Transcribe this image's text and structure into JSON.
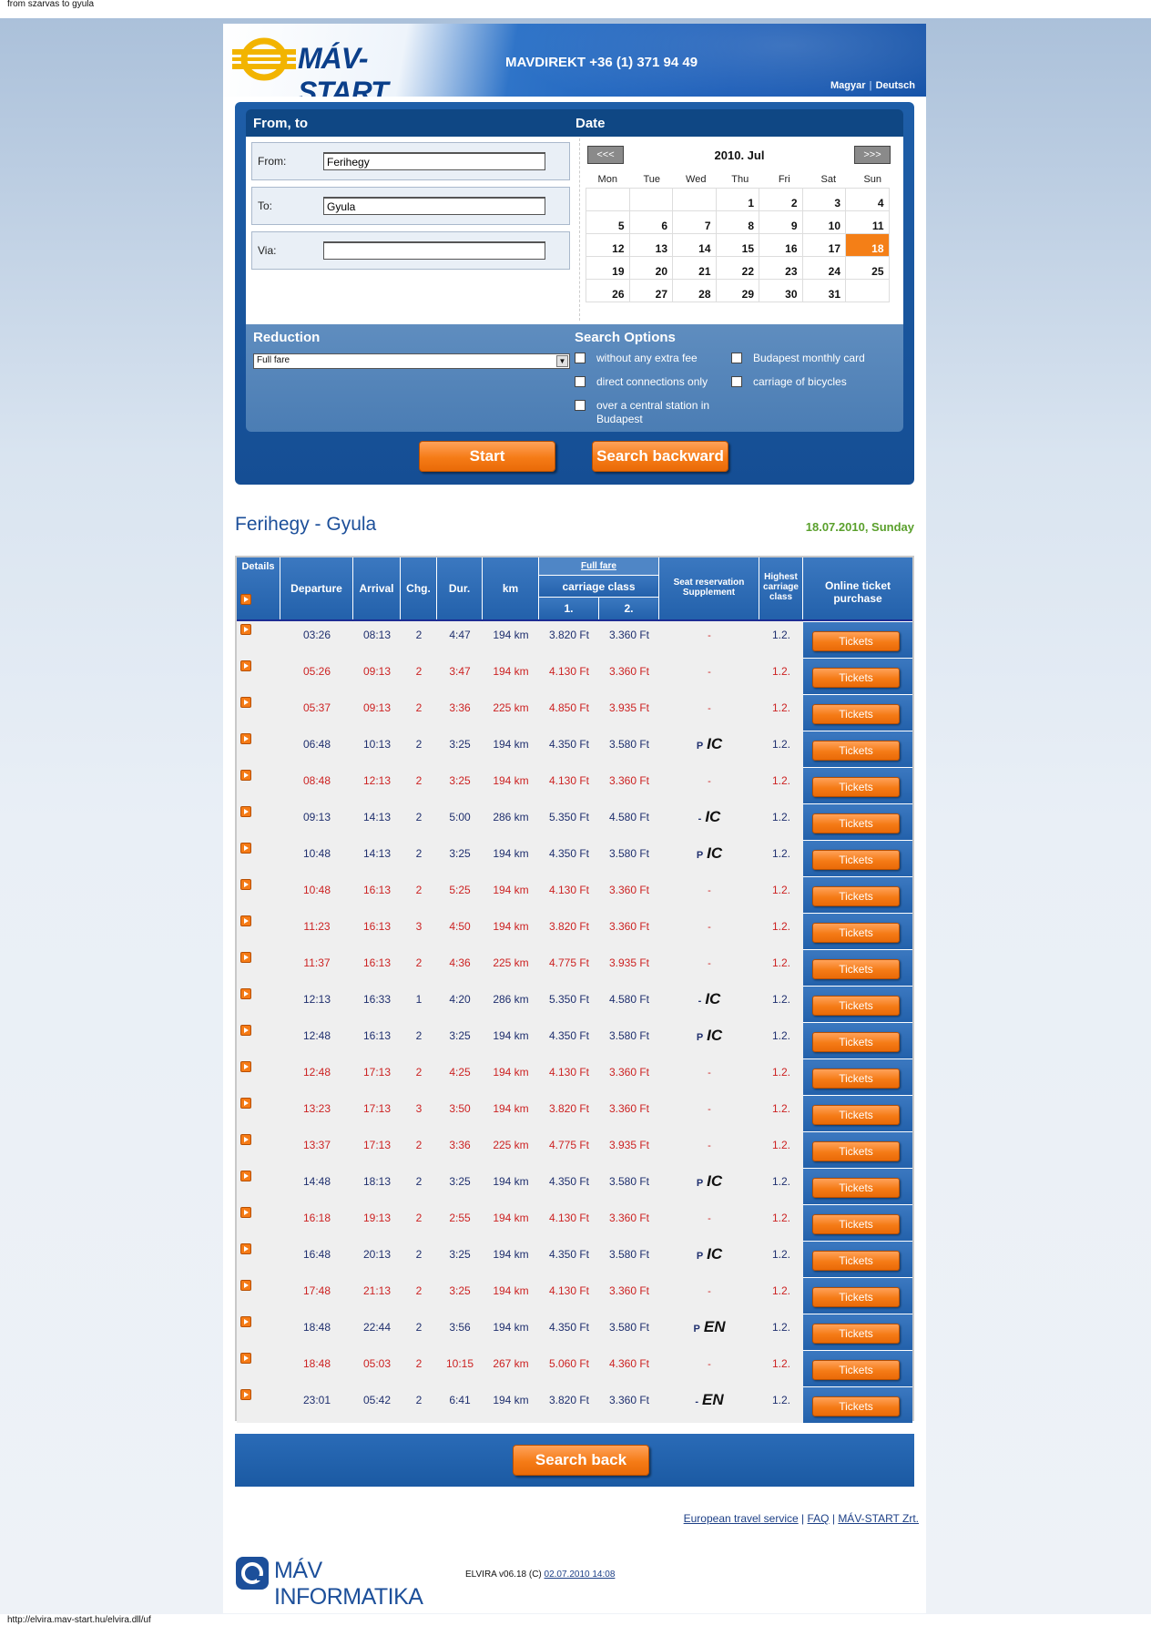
{
  "browser": {
    "page_title": "from szarvas to gyula",
    "status_url": "http://elvira.mav-start.hu/elvira.dll/uf"
  },
  "header": {
    "logo_text": "MÁV-START",
    "phone": "MAVDIREKT +36 (1) 371 94 49",
    "langs": [
      "Magyar",
      "Deutsch"
    ]
  },
  "search": {
    "from_to_title": "From, to",
    "date_title": "Date",
    "from_label": "From:",
    "from_value": "Ferihegy",
    "to_label": "To:",
    "to_value": "Gyula",
    "via_label": "Via:",
    "via_value": ""
  },
  "calendar": {
    "prev": "<<<",
    "next": ">>>",
    "title": "2010. Jul",
    "dow": [
      "Mon",
      "Tue",
      "Wed",
      "Thu",
      "Fri",
      "Sat",
      "Sun"
    ],
    "weeks": [
      [
        "",
        "",
        "",
        "1",
        "2",
        "3",
        "4"
      ],
      [
        "5",
        "6",
        "7",
        "8",
        "9",
        "10",
        "11"
      ],
      [
        "12",
        "13",
        "14",
        "15",
        "16",
        "17",
        "18"
      ],
      [
        "19",
        "20",
        "21",
        "22",
        "23",
        "24",
        "25"
      ],
      [
        "26",
        "27",
        "28",
        "29",
        "30",
        "31",
        ""
      ]
    ],
    "selected": "18"
  },
  "reduction": {
    "title": "Reduction",
    "selected": "Full fare"
  },
  "options": {
    "title": "Search Options",
    "items": [
      "without any extra fee",
      "direct connections only",
      "over a central station in Budapest",
      "Budapest monthly card",
      "carriage of bicycles"
    ]
  },
  "buttons": {
    "start": "Start",
    "search_backward": "Search backward",
    "search_back": "Search back"
  },
  "route": {
    "title": "Ferihegy - Gyula",
    "date": "18.07.2010, Sunday"
  },
  "table": {
    "headers": {
      "details": "Details",
      "departure": "Departure",
      "arrival": "Arrival",
      "changes": "Chg.",
      "duration": "Dur.",
      "km": "km",
      "full_fare": "Full fare",
      "carriage_class": "carriage class",
      "class1": "1.",
      "class2": "2.",
      "seat": "Seat reservation Supplement",
      "highest": "Highest carriage class",
      "online": "Online ticket purchase"
    },
    "ticket_label": "Tickets",
    "rows": [
      {
        "dep": "03:26",
        "arr": "08:13",
        "chg": "2",
        "dur": "4:47",
        "km": "194 km",
        "c1": "3.820 Ft",
        "c2": "3.360 Ft",
        "seat_mark": "",
        "seat_type": "",
        "seat_text": "-",
        "cls": "1.2.",
        "color": "blue"
      },
      {
        "dep": "05:26",
        "arr": "09:13",
        "chg": "2",
        "dur": "3:47",
        "km": "194 km",
        "c1": "4.130 Ft",
        "c2": "3.360 Ft",
        "seat_mark": "",
        "seat_type": "",
        "seat_text": "-",
        "cls": "1.2.",
        "color": "red"
      },
      {
        "dep": "05:37",
        "arr": "09:13",
        "chg": "2",
        "dur": "3:36",
        "km": "225 km",
        "c1": "4.850 Ft",
        "c2": "3.935 Ft",
        "seat_mark": "",
        "seat_type": "",
        "seat_text": "-",
        "cls": "1.2.",
        "color": "red"
      },
      {
        "dep": "06:48",
        "arr": "10:13",
        "chg": "2",
        "dur": "3:25",
        "km": "194 km",
        "c1": "4.350 Ft",
        "c2": "3.580 Ft",
        "seat_mark": "P",
        "seat_type": "IC",
        "seat_text": "",
        "cls": "1.2.",
        "color": "blue"
      },
      {
        "dep": "08:48",
        "arr": "12:13",
        "chg": "2",
        "dur": "3:25",
        "km": "194 km",
        "c1": "4.130 Ft",
        "c2": "3.360 Ft",
        "seat_mark": "",
        "seat_type": "",
        "seat_text": "-",
        "cls": "1.2.",
        "color": "red"
      },
      {
        "dep": "09:13",
        "arr": "14:13",
        "chg": "2",
        "dur": "5:00",
        "km": "286 km",
        "c1": "5.350 Ft",
        "c2": "4.580 Ft",
        "seat_mark": "-",
        "seat_type": "IC",
        "seat_text": "",
        "cls": "1.2.",
        "color": "blue"
      },
      {
        "dep": "10:48",
        "arr": "14:13",
        "chg": "2",
        "dur": "3:25",
        "km": "194 km",
        "c1": "4.350 Ft",
        "c2": "3.580 Ft",
        "seat_mark": "P",
        "seat_type": "IC",
        "seat_text": "",
        "cls": "1.2.",
        "color": "blue"
      },
      {
        "dep": "10:48",
        "arr": "16:13",
        "chg": "2",
        "dur": "5:25",
        "km": "194 km",
        "c1": "4.130 Ft",
        "c2": "3.360 Ft",
        "seat_mark": "",
        "seat_type": "",
        "seat_text": "-",
        "cls": "1.2.",
        "color": "red"
      },
      {
        "dep": "11:23",
        "arr": "16:13",
        "chg": "3",
        "dur": "4:50",
        "km": "194 km",
        "c1": "3.820 Ft",
        "c2": "3.360 Ft",
        "seat_mark": "",
        "seat_type": "",
        "seat_text": "-",
        "cls": "1.2.",
        "color": "red"
      },
      {
        "dep": "11:37",
        "arr": "16:13",
        "chg": "2",
        "dur": "4:36",
        "km": "225 km",
        "c1": "4.775 Ft",
        "c2": "3.935 Ft",
        "seat_mark": "",
        "seat_type": "",
        "seat_text": "-",
        "cls": "1.2.",
        "color": "red"
      },
      {
        "dep": "12:13",
        "arr": "16:33",
        "chg": "1",
        "dur": "4:20",
        "km": "286 km",
        "c1": "5.350 Ft",
        "c2": "4.580 Ft",
        "seat_mark": "-",
        "seat_type": "IC",
        "seat_text": "",
        "cls": "1.2.",
        "color": "blue"
      },
      {
        "dep": "12:48",
        "arr": "16:13",
        "chg": "2",
        "dur": "3:25",
        "km": "194 km",
        "c1": "4.350 Ft",
        "c2": "3.580 Ft",
        "seat_mark": "P",
        "seat_type": "IC",
        "seat_text": "",
        "cls": "1.2.",
        "color": "blue"
      },
      {
        "dep": "12:48",
        "arr": "17:13",
        "chg": "2",
        "dur": "4:25",
        "km": "194 km",
        "c1": "4.130 Ft",
        "c2": "3.360 Ft",
        "seat_mark": "",
        "seat_type": "",
        "seat_text": "-",
        "cls": "1.2.",
        "color": "red"
      },
      {
        "dep": "13:23",
        "arr": "17:13",
        "chg": "3",
        "dur": "3:50",
        "km": "194 km",
        "c1": "3.820 Ft",
        "c2": "3.360 Ft",
        "seat_mark": "",
        "seat_type": "",
        "seat_text": "-",
        "cls": "1.2.",
        "color": "red"
      },
      {
        "dep": "13:37",
        "arr": "17:13",
        "chg": "2",
        "dur": "3:36",
        "km": "225 km",
        "c1": "4.775 Ft",
        "c2": "3.935 Ft",
        "seat_mark": "",
        "seat_type": "",
        "seat_text": "-",
        "cls": "1.2.",
        "color": "red"
      },
      {
        "dep": "14:48",
        "arr": "18:13",
        "chg": "2",
        "dur": "3:25",
        "km": "194 km",
        "c1": "4.350 Ft",
        "c2": "3.580 Ft",
        "seat_mark": "P",
        "seat_type": "IC",
        "seat_text": "",
        "cls": "1.2.",
        "color": "blue"
      },
      {
        "dep": "16:18",
        "arr": "19:13",
        "chg": "2",
        "dur": "2:55",
        "km": "194 km",
        "c1": "4.130 Ft",
        "c2": "3.360 Ft",
        "seat_mark": "",
        "seat_type": "",
        "seat_text": "-",
        "cls": "1.2.",
        "color": "red"
      },
      {
        "dep": "16:48",
        "arr": "20:13",
        "chg": "2",
        "dur": "3:25",
        "km": "194 km",
        "c1": "4.350 Ft",
        "c2": "3.580 Ft",
        "seat_mark": "P",
        "seat_type": "IC",
        "seat_text": "",
        "cls": "1.2.",
        "color": "blue"
      },
      {
        "dep": "17:48",
        "arr": "21:13",
        "chg": "2",
        "dur": "3:25",
        "km": "194 km",
        "c1": "4.130 Ft",
        "c2": "3.360 Ft",
        "seat_mark": "",
        "seat_type": "",
        "seat_text": "-",
        "cls": "1.2.",
        "color": "red"
      },
      {
        "dep": "18:48",
        "arr": "22:44",
        "chg": "2",
        "dur": "3:56",
        "km": "194 km",
        "c1": "4.350 Ft",
        "c2": "3.580 Ft",
        "seat_mark": "P",
        "seat_type": "EN",
        "seat_text": "",
        "cls": "1.2.",
        "color": "blue"
      },
      {
        "dep": "18:48",
        "arr": "05:03",
        "chg": "2",
        "dur": "10:15",
        "km": "267 km",
        "c1": "5.060 Ft",
        "c2": "4.360 Ft",
        "seat_mark": "",
        "seat_type": "",
        "seat_text": "-",
        "cls": "1.2.",
        "color": "red"
      },
      {
        "dep": "23:01",
        "arr": "05:42",
        "chg": "2",
        "dur": "6:41",
        "km": "194 km",
        "c1": "3.820 Ft",
        "c2": "3.360 Ft",
        "seat_mark": "-",
        "seat_type": "EN",
        "seat_text": "",
        "cls": "1.2.",
        "color": "blue"
      }
    ]
  },
  "footer": {
    "links": [
      "European travel service",
      "FAQ",
      "MÁV-START Zrt."
    ],
    "infologo": "MÁV INFORMATIKA",
    "elvira_text": "ELVIRA v06.18 (C)",
    "elvira_date": "02.07.2010 14:08"
  },
  "colors": {
    "orange": "#f57b16",
    "blue_dark": "#154e94",
    "route_blue": "#1c4f9a",
    "date_green": "#5aa02c",
    "red_row": "#cc2222",
    "blue_row": "#1f2f6e"
  }
}
